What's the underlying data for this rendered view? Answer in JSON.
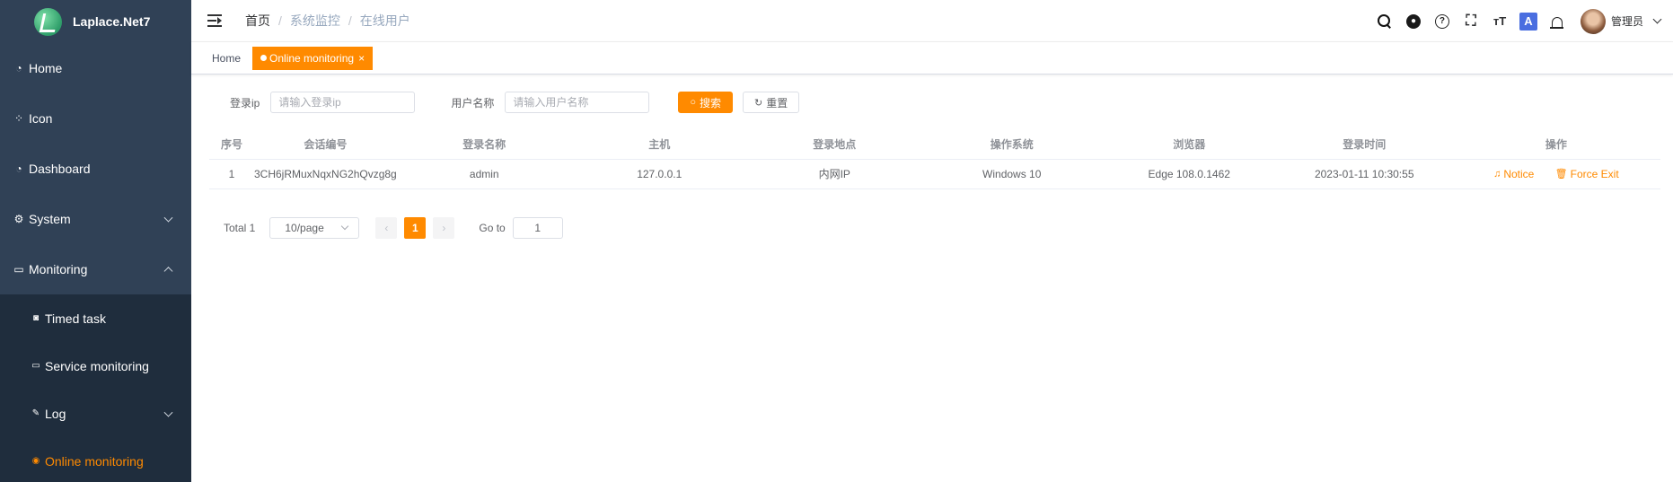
{
  "app": {
    "title": "Laplace.Net7"
  },
  "sidebar": {
    "items": [
      {
        "label": "Home",
        "icon": "dashboard-icon"
      },
      {
        "label": "Icon",
        "icon": "grid-icon"
      },
      {
        "label": "Dashboard",
        "icon": "dashboard-icon"
      },
      {
        "label": "System",
        "icon": "gear-icon",
        "expanded": false
      },
      {
        "label": "Monitoring",
        "icon": "monitor-icon",
        "expanded": true
      }
    ],
    "submenu": [
      {
        "label": "Timed task",
        "icon": "timer-icon"
      },
      {
        "label": "Service monitoring",
        "icon": "server-icon"
      },
      {
        "label": "Log",
        "icon": "edit-icon",
        "expanded": false
      },
      {
        "label": "Online monitoring",
        "icon": "online-icon",
        "active": true
      }
    ],
    "colors": {
      "background": "#304156",
      "submenu_background": "#1f2d3d",
      "active": "#ff8a00"
    }
  },
  "header": {
    "breadcrumb": [
      "首页",
      "系统监控",
      "在线用户"
    ],
    "separator": "/",
    "tools": [
      "search-icon",
      "github-icon",
      "help-icon",
      "fullscreen-icon",
      "font-size-icon",
      "translate-icon",
      "bell-icon"
    ],
    "translate_glyph": "A",
    "font_glyph": "тT",
    "user": {
      "name": "管理员"
    }
  },
  "tags": [
    {
      "label": "Home",
      "active": false
    },
    {
      "label": "Online monitoring",
      "active": true,
      "close": "×"
    }
  ],
  "search": {
    "ip_label": "登录ip",
    "ip_placeholder": "请输入登录ip",
    "user_label": "用户名称",
    "user_placeholder": "请输入用户名称",
    "search_button": "搜索",
    "reset_button": "重置"
  },
  "table": {
    "columns": [
      "序号",
      "会话编号",
      "登录名称",
      "主机",
      "登录地点",
      "操作系统",
      "浏览器",
      "登录时间",
      "操作"
    ],
    "rows": [
      {
        "index": "1",
        "session": "3CH6jRMuxNqxNG2hQvzg8g",
        "login_name": "admin",
        "host": "127.0.0.1",
        "location": "内网IP",
        "os": "Windows 10",
        "browser": "Edge 108.0.1462",
        "login_time": "2023-01-11 10:30:55",
        "actions": {
          "notice": "Notice",
          "force_exit": "Force Exit"
        }
      }
    ]
  },
  "pagination": {
    "total": "Total 1",
    "page_size": "10/page",
    "current_page": "1",
    "prev": "‹",
    "next": "›",
    "goto_label": "Go to",
    "goto_value": "1"
  },
  "accent_color": "#ff8a00"
}
